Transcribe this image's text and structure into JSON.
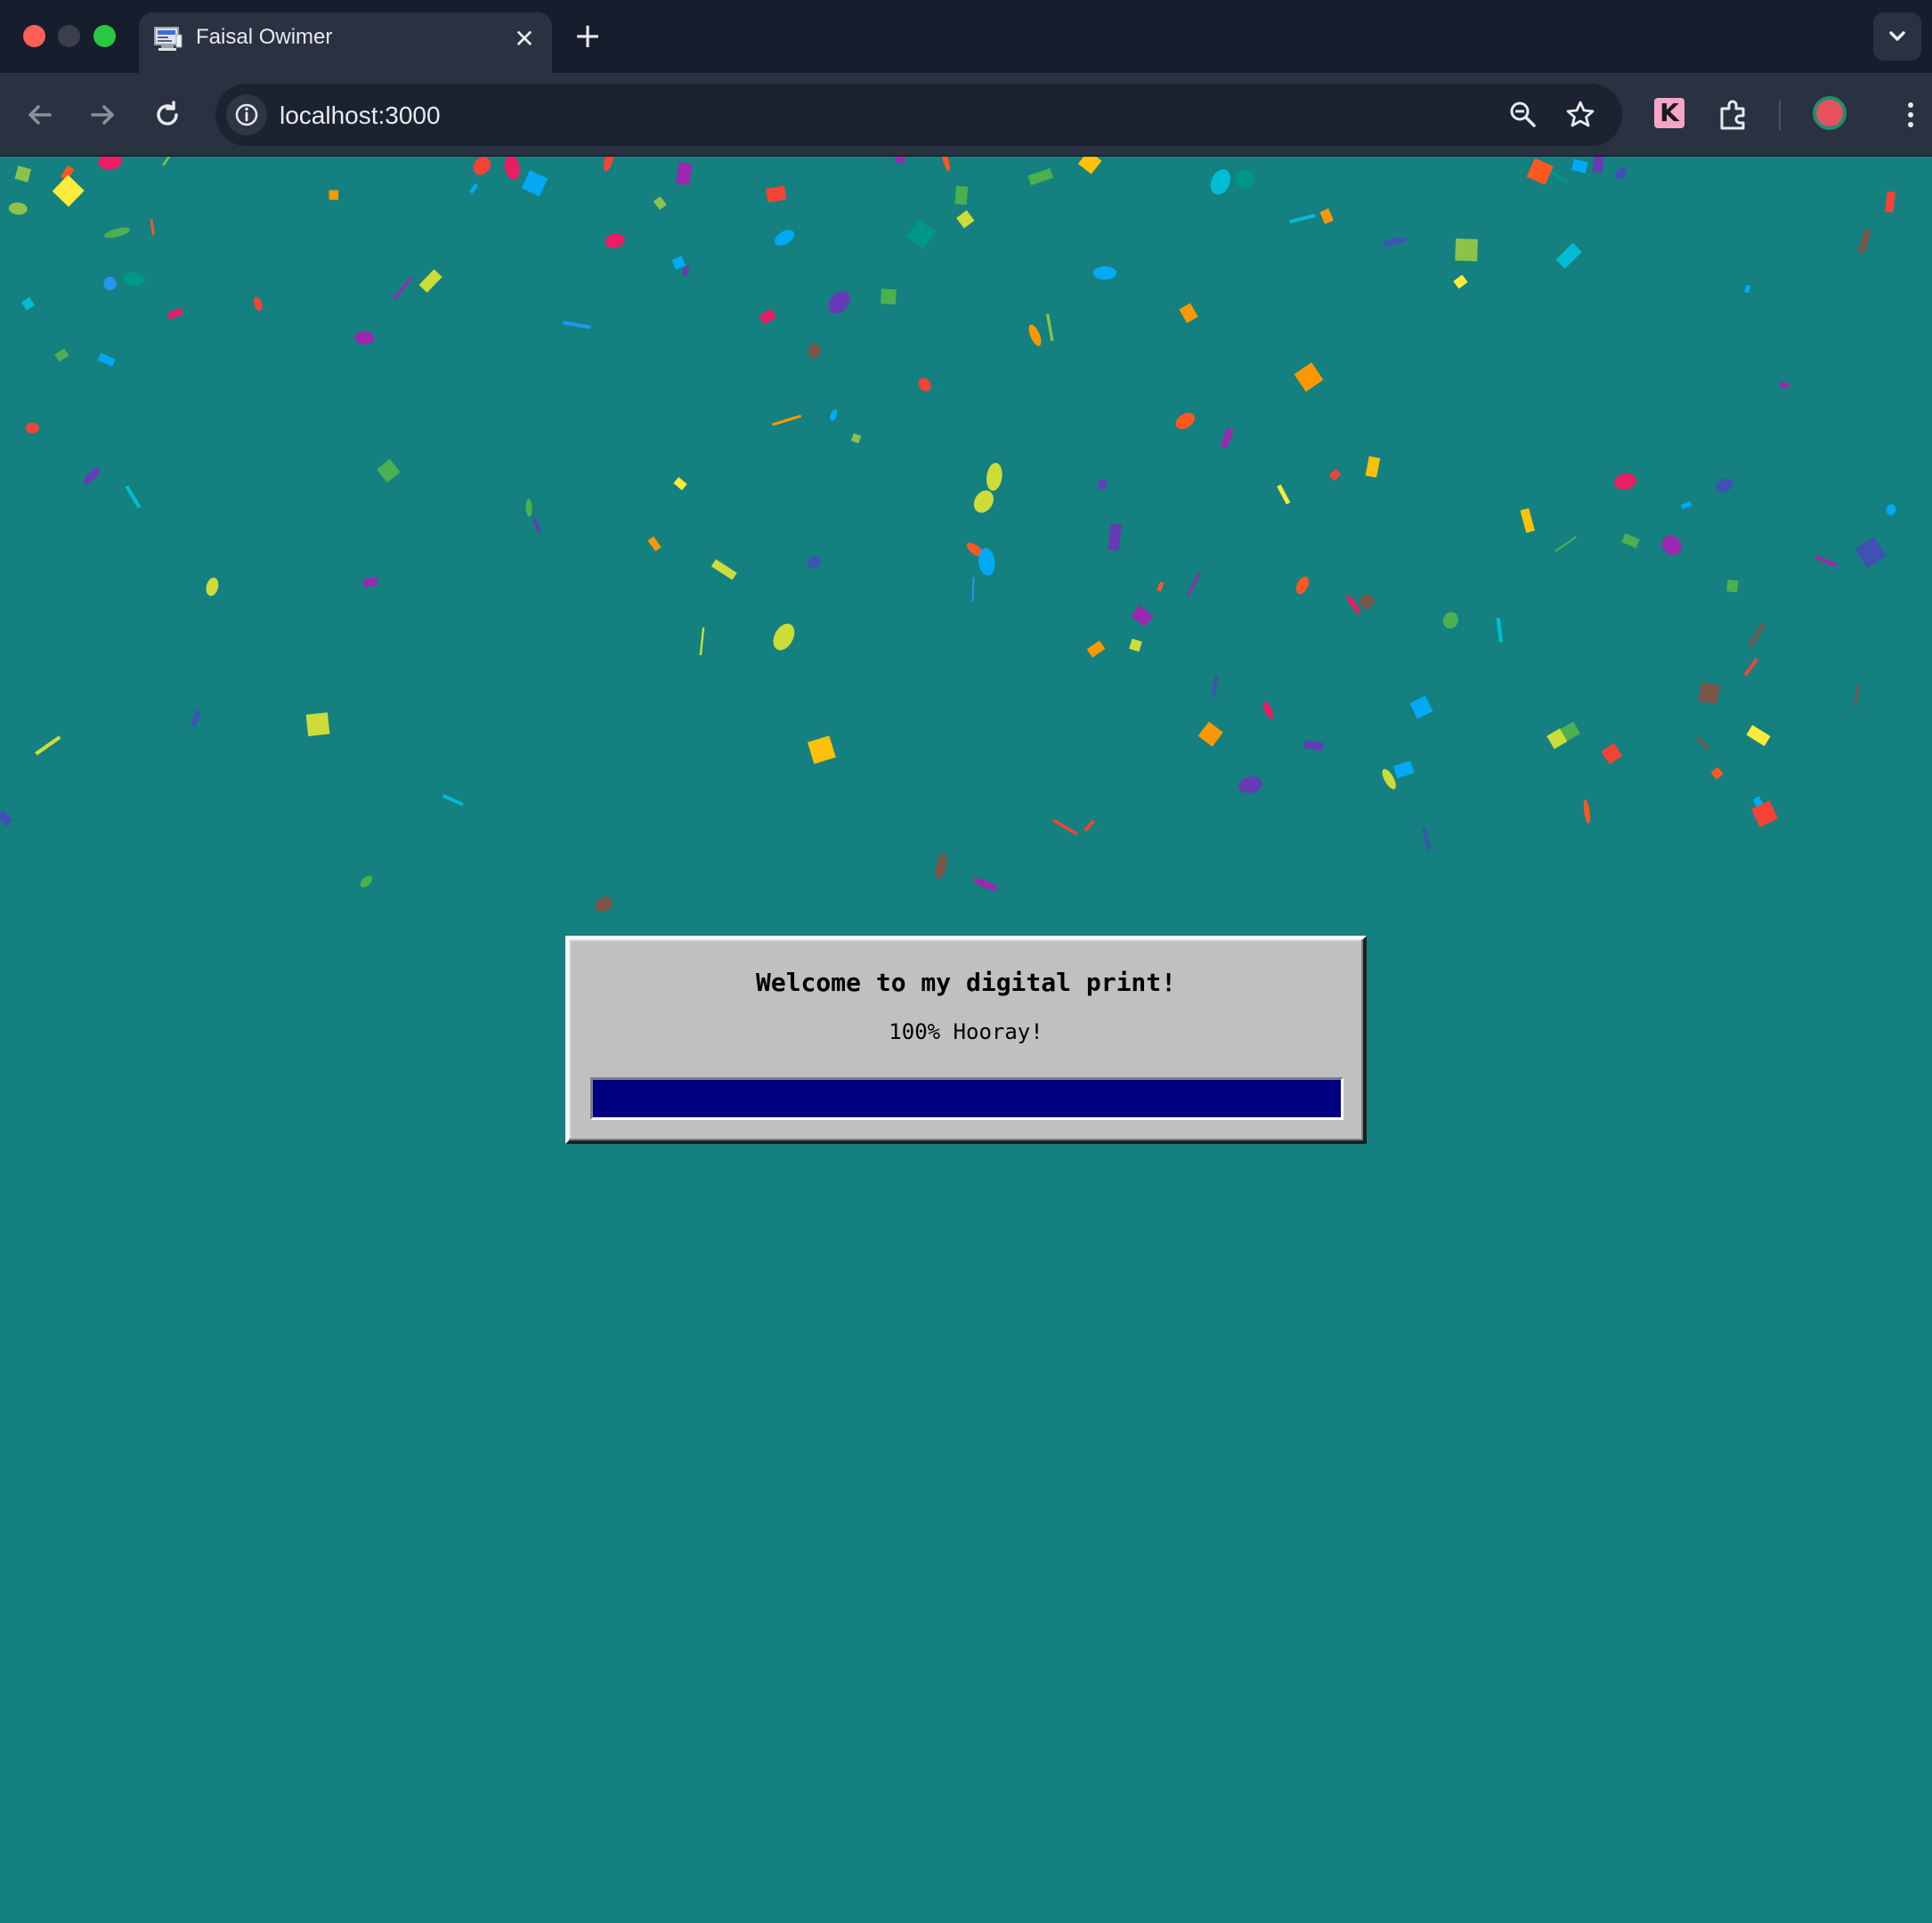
{
  "window": {
    "traffic_lights": [
      "close",
      "minimize",
      "maximize"
    ]
  },
  "tab": {
    "title": "Faisal Owimer",
    "favicon": "computer-favicon-icon",
    "close_icon": "close-icon"
  },
  "toolbar": {
    "url": "localhost:3000",
    "buttons": [
      "back-arrow-icon",
      "forward-arrow-icon",
      "reload-icon"
    ],
    "omnibox_icons": [
      "info-icon",
      "zoom-out-icon",
      "star-icon"
    ],
    "extension_k_label": "K"
  },
  "dialog": {
    "title": "Welcome to my digital print!",
    "status": "100% Hooray!",
    "progress": 1.0,
    "colors": {
      "face": "#c0c0c0",
      "fill": "#000080"
    }
  },
  "theme": {
    "page_background": "#14807f",
    "confetti_colors": [
      "#f44336",
      "#e91e63",
      "#9c27b0",
      "#673ab7",
      "#3f51b5",
      "#2196f3",
      "#03a9f4",
      "#00bcd4",
      "#009688",
      "#4caf50",
      "#8bc34a",
      "#cddc39",
      "#ffeb3b",
      "#ffc107",
      "#ff9800",
      "#ff5722",
      "#795548"
    ]
  }
}
